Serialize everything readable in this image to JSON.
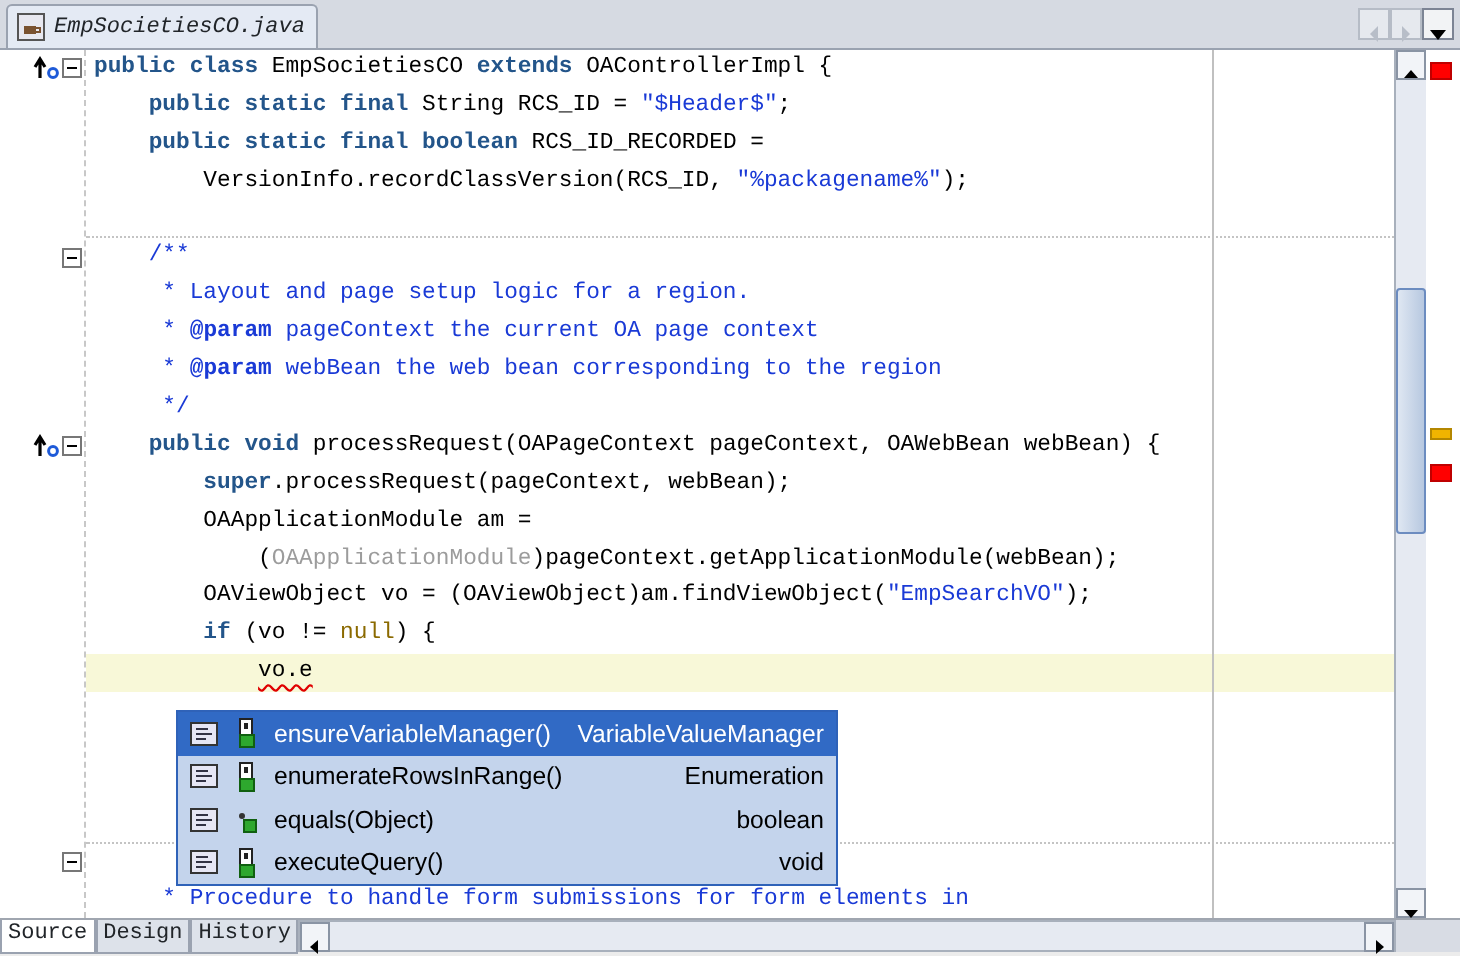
{
  "file_tab": {
    "label": "EmpSocietiesCO.java",
    "selected": true
  },
  "code_lines": [
    {
      "kind": "code",
      "overrides": true,
      "fold": true,
      "tokens": [
        {
          "kind": "kw",
          "text": "public class"
        },
        {
          "kind": "plain",
          "text": " EmpSocietiesCO "
        },
        {
          "kind": "kw",
          "text": "extends"
        },
        {
          "kind": "plain",
          "text": " OAControllerImpl {"
        }
      ]
    },
    {
      "kind": "code",
      "tokens": [
        {
          "kind": "kw",
          "text": "    public static final"
        },
        {
          "kind": "plain",
          "text": " String RCS_ID = "
        },
        {
          "kind": "str",
          "text": "\"$Header$\""
        },
        {
          "kind": "plain",
          "text": ";"
        }
      ]
    },
    {
      "kind": "code",
      "tokens": [
        {
          "kind": "kw",
          "text": "    public static final boolean"
        },
        {
          "kind": "plain",
          "text": " RCS_ID_RECORDED ="
        }
      ]
    },
    {
      "kind": "code",
      "tokens": [
        {
          "kind": "plain",
          "text": "        VersionInfo.recordClassVersion(RCS_ID, "
        },
        {
          "kind": "str",
          "text": "\"%packagename%\""
        },
        {
          "kind": "plain",
          "text": ");"
        }
      ]
    },
    {
      "kind": "blank",
      "separator_after": true
    },
    {
      "kind": "code",
      "fold": true,
      "tokens": [
        {
          "kind": "doc",
          "text": "    /**"
        }
      ]
    },
    {
      "kind": "code",
      "tokens": [
        {
          "kind": "doc",
          "text": "     * Layout and page setup logic for a region."
        }
      ]
    },
    {
      "kind": "code",
      "tokens": [
        {
          "kind": "doc",
          "text": "     * "
        },
        {
          "kind": "doctag",
          "text": "@param"
        },
        {
          "kind": "doc",
          "text": " pageContext the current OA page context"
        }
      ]
    },
    {
      "kind": "code",
      "tokens": [
        {
          "kind": "doc",
          "text": "     * "
        },
        {
          "kind": "doctag",
          "text": "@param"
        },
        {
          "kind": "doc",
          "text": " webBean the web bean corresponding to the region"
        }
      ]
    },
    {
      "kind": "code",
      "tokens": [
        {
          "kind": "doc",
          "text": "     */"
        }
      ]
    },
    {
      "kind": "code",
      "overrides": true,
      "fold": true,
      "tokens": [
        {
          "kind": "kw",
          "text": "    public void"
        },
        {
          "kind": "plain",
          "text": " processRequest(OAPageContext pageContext, OAWebBean webBean) {"
        }
      ]
    },
    {
      "kind": "code",
      "tokens": [
        {
          "kind": "kw",
          "text": "        super"
        },
        {
          "kind": "plain",
          "text": ".processRequest(pageContext, webBean);"
        }
      ]
    },
    {
      "kind": "code",
      "tokens": [
        {
          "kind": "plain",
          "text": "        OAApplicationModule am ="
        }
      ]
    },
    {
      "kind": "code",
      "tokens": [
        {
          "kind": "plain",
          "text": "            ("
        },
        {
          "kind": "dim",
          "text": "OAApplicationModule"
        },
        {
          "kind": "plain",
          "text": ")pageContext.getApplicationModule(webBean);"
        }
      ]
    },
    {
      "kind": "code",
      "tokens": [
        {
          "kind": "plain",
          "text": "        OAViewObject vo = (OAViewObject)am.findViewObject("
        },
        {
          "kind": "str",
          "text": "\"EmpSearchVO\""
        },
        {
          "kind": "plain",
          "text": ");"
        }
      ]
    },
    {
      "kind": "code",
      "tokens": [
        {
          "kind": "kw",
          "text": "        if"
        },
        {
          "kind": "plain",
          "text": " (vo != "
        },
        {
          "kind": "null",
          "text": "null"
        },
        {
          "kind": "plain",
          "text": ") {"
        }
      ]
    },
    {
      "kind": "code",
      "current": true,
      "tokens": [
        {
          "kind": "error",
          "text": "            vo.e"
        }
      ]
    },
    {
      "kind": "blank"
    },
    {
      "kind": "blank"
    },
    {
      "kind": "blank"
    },
    {
      "kind": "blank",
      "separator_after": true
    },
    {
      "kind": "blank",
      "fold": true
    },
    {
      "kind": "code",
      "tokens": [
        {
          "kind": "doc",
          "text": "     * Procedure to handle form submissions for form elements in"
        }
      ]
    }
  ],
  "completion_popup": {
    "items": [
      {
        "name": "ensureVariableManager()",
        "type": "VariableValueManager",
        "selected": true,
        "kind": "method"
      },
      {
        "name": "enumerateRowsInRange()",
        "type": "Enumeration",
        "selected": false,
        "kind": "method"
      },
      {
        "name": "equals(Object)",
        "type": "boolean",
        "selected": false,
        "kind": "inherited"
      },
      {
        "name": "executeQuery()",
        "type": "void",
        "selected": false,
        "kind": "method"
      }
    ]
  },
  "markers": [
    {
      "kind": "error",
      "color": "#ff0000"
    },
    {
      "kind": "warning",
      "color": "#f0b400"
    },
    {
      "kind": "error",
      "color": "#ff0000"
    }
  ],
  "bottom_tabs": [
    {
      "label": "Source",
      "selected": true
    },
    {
      "label": "Design",
      "selected": false
    },
    {
      "label": "History",
      "selected": false
    }
  ]
}
